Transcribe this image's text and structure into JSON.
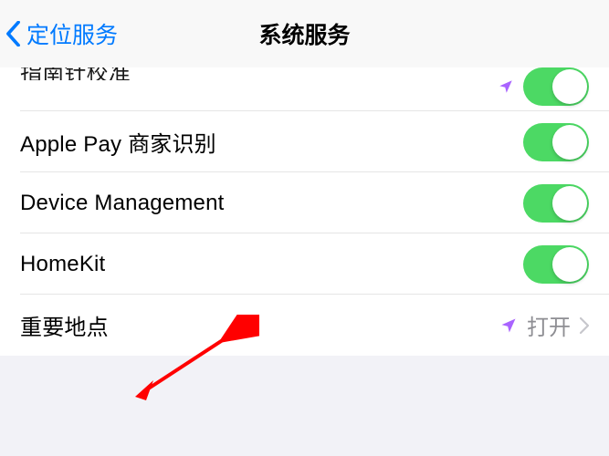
{
  "nav": {
    "back_label": "定位服务",
    "title": "系统服务"
  },
  "rows": {
    "compass": {
      "label": "指南针校准",
      "on": true
    },
    "applepay": {
      "label": "Apple Pay 商家识别",
      "on": true
    },
    "devmgmt": {
      "label": "Device Management",
      "on": true
    },
    "homekit": {
      "label": "HomeKit",
      "on": true
    },
    "significant": {
      "label": "重要地点",
      "value": "打开"
    }
  }
}
